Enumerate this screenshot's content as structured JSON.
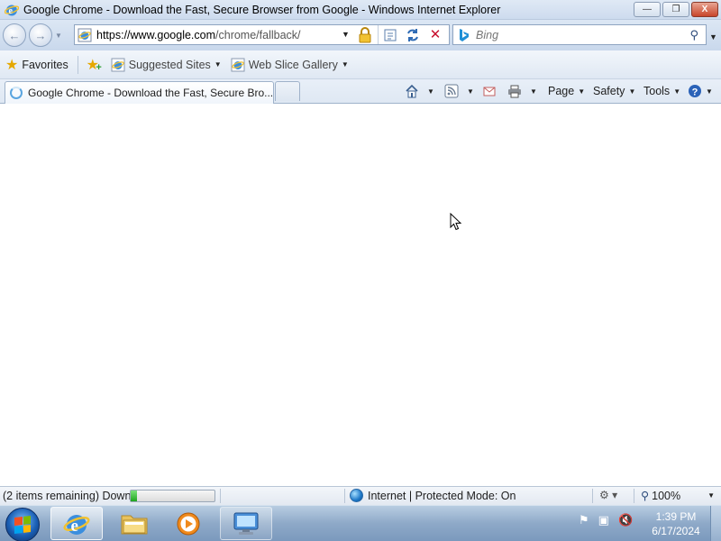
{
  "window": {
    "title": "Google Chrome - Download the Fast, Secure Browser from Google - Windows Internet Explorer",
    "controls": {
      "minimize": "—",
      "maximize": "❐",
      "close": "X"
    }
  },
  "navigation": {
    "back_glyph": "←",
    "forward_glyph": "→",
    "address": {
      "protocol_host": "https://www.google.com",
      "path": "/chrome/fallback/"
    },
    "stop_glyph": "✕",
    "search": {
      "placeholder": "Bing",
      "engine_icon": "bing-icon"
    }
  },
  "favorites_bar": {
    "favorites_label": "Favorites",
    "links": [
      {
        "label": "Suggested Sites"
      },
      {
        "label": "Web Slice Gallery"
      }
    ]
  },
  "tabs": [
    {
      "title": "Google Chrome - Download the Fast, Secure Bro...",
      "loading": true
    }
  ],
  "command_bar": {
    "page_label": "Page",
    "safety_label": "Safety",
    "tools_label": "Tools"
  },
  "status_bar": {
    "text": "(2 items remaining) Down",
    "progress_fraction": 0.08,
    "zone": "Internet | Protected Mode: On",
    "zoom": "100%"
  },
  "taskbar": {
    "clock_time": "1:39 PM",
    "clock_date": "6/17/2024"
  },
  "colors": {
    "chrome_bg": "#dce7f4",
    "progress_fill": "#1fa51f",
    "stop_red": "#c8102e",
    "favorites_star": "#e5a800"
  }
}
